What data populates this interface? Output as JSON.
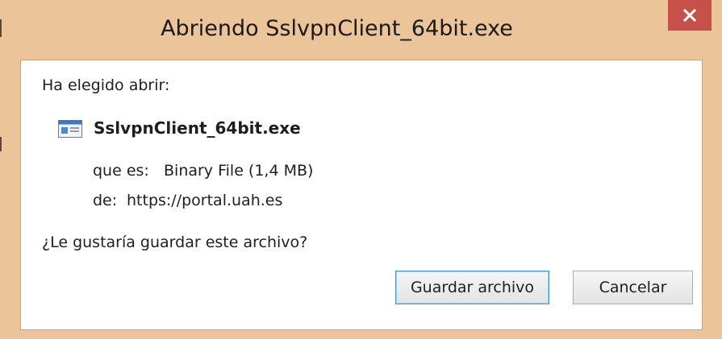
{
  "window": {
    "title": "Abriendo SslvpnClient_64bit.exe",
    "close_icon": "close-icon",
    "frame_color": "#ecc49a",
    "close_color": "#c7504a"
  },
  "dialog": {
    "intro": "Ha elegido abrir:",
    "file_icon": "executable-file-icon",
    "filename": "SslvpnClient_64bit.exe",
    "type_label": "que es:",
    "type_value": "Binary File (1,4 MB)",
    "from_label": "de:",
    "from_value": "https://portal.uah.es",
    "question": "¿Le gustaría guardar este archivo?"
  },
  "buttons": {
    "save_label": "Guardar archivo",
    "cancel_label": "Cancelar"
  }
}
